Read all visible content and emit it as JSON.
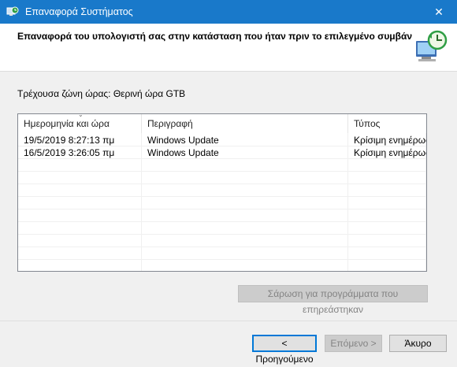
{
  "window": {
    "title": "Επαναφορά Συστήματος",
    "close_glyph": "✕"
  },
  "header": {
    "heading": "Επαναφορά του υπολογιστή σας στην κατάσταση που ήταν πριν το επιλεγμένο συμβάν"
  },
  "timezone_label": "Τρέχουσα ζώνη ώρας: Θερινή ώρα GTB",
  "table": {
    "columns": [
      "Ημερομηνία και ώρα",
      "Περιγραφή",
      "Τύπος"
    ],
    "rows": [
      [
        "19/5/2019 8:27:13 πμ",
        "Windows Update",
        "Κρίσιμη ενημέρωση"
      ],
      [
        "16/5/2019 3:26:05 πμ",
        "Windows Update",
        "Κρίσιμη ενημέρωση"
      ]
    ]
  },
  "buttons": {
    "scan": "Σάρωση για προγράμματα που επηρεάστηκαν",
    "back": "< Προηγούμενο",
    "next": "Επόμενο >",
    "cancel": "Άκυρο"
  },
  "colors": {
    "titlebar": "#1979ca",
    "default_button_border": "#0078d7"
  },
  "icons": {
    "app": "system-restore-icon",
    "header": "computer-restore-icon"
  }
}
